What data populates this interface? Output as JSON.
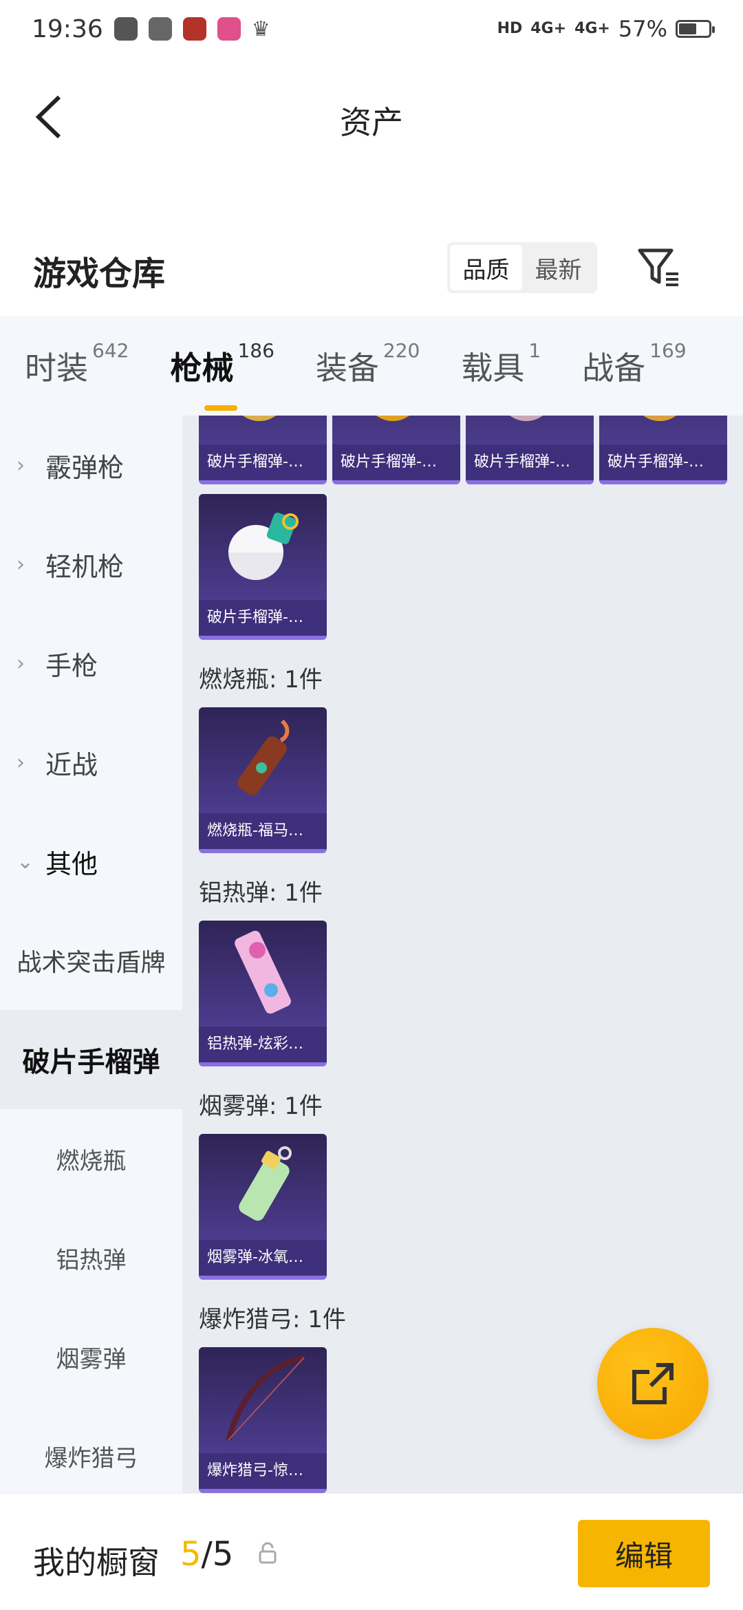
{
  "status_bar": {
    "time": "19:36",
    "signal_1": "4G+",
    "signal_2": "4G+",
    "hd": "HD",
    "battery_text": "57%",
    "battery_level": 0.57
  },
  "header": {
    "title": "资产"
  },
  "warehouse": {
    "title": "游戏仓库",
    "sort_options": [
      "品质",
      "最新"
    ],
    "active_sort": "品质"
  },
  "tabs": [
    {
      "label": "时装",
      "count": "642"
    },
    {
      "label": "枪械",
      "count": "186",
      "active": true
    },
    {
      "label": "装备",
      "count": "220"
    },
    {
      "label": "载具",
      "count": "1"
    },
    {
      "label": "战备",
      "count": "169"
    }
  ],
  "sidebar": {
    "items": [
      {
        "label": "霰弹枪"
      },
      {
        "label": "轻机枪"
      },
      {
        "label": "手枪"
      },
      {
        "label": "近战"
      },
      {
        "label": "其他"
      },
      {
        "label": "战术突击盾牌"
      },
      {
        "label": "破片手榴弹"
      },
      {
        "label": "燃烧瓶"
      },
      {
        "label": "铝热弹"
      },
      {
        "label": "烟雾弹"
      },
      {
        "label": "爆炸猎弓"
      }
    ]
  },
  "content": {
    "top_cards": [
      "破片手榴弹-…",
      "破片手榴弹-…",
      "破片手榴弹-…",
      "破片手榴弹-…"
    ],
    "grenade_card": "破片手榴弹-…",
    "sections": [
      {
        "label": "燃烧瓶: 1件",
        "card": "燃烧瓶-福马…"
      },
      {
        "label": "铝热弹: 1件",
        "card": "铝热弹-炫彩…"
      },
      {
        "label": "烟雾弹: 1件",
        "card": "烟雾弹-冰氧…"
      },
      {
        "label": "爆炸猎弓: 1件",
        "card": "爆炸猎弓-惊…"
      }
    ]
  },
  "bottom": {
    "window_label": "我的橱窗",
    "count_current": "5",
    "count_sep": "/",
    "count_total": "5",
    "edit_label": "编辑"
  },
  "colors": {
    "accent": "#f6b500",
    "card_bg": "#4a3a8a",
    "sidebar_bg": "#f4f7fb",
    "content_bg": "#e9edf2"
  }
}
